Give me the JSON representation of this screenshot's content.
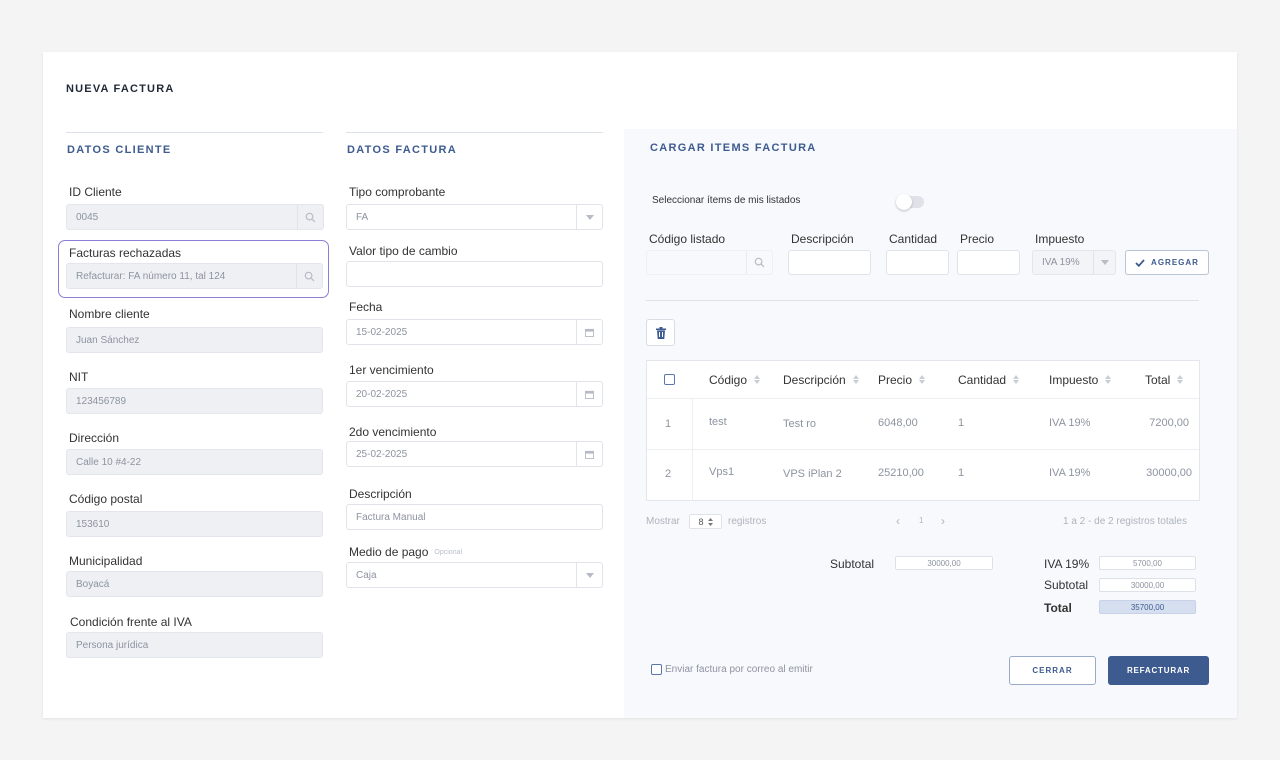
{
  "page": {
    "title": "NUEVA FACTURA"
  },
  "cliente": {
    "section_title": "DATOS CLIENTE",
    "id_label": "ID Cliente",
    "id_value": "0045",
    "rechazadas_label": "Facturas rechazadas",
    "rechazadas_value": "Refacturar: FA número 11, tal 124",
    "nombre_label": "Nombre cliente",
    "nombre_value": "Juan Sánchez",
    "nit_label": "NIT",
    "nit_value": "123456789",
    "direccion_label": "Dirección",
    "direccion_value": "Calle 10 #4-22",
    "postal_label": "Código postal",
    "postal_value": "153610",
    "municipalidad_label": "Municipalidad",
    "municipalidad_value": "Boyacá",
    "iva_label": "Condición frente al IVA",
    "iva_value": "Persona jurídica"
  },
  "factura": {
    "section_title": "DATOS FACTURA",
    "tipo_label": "Tipo comprobante",
    "tipo_value": "FA",
    "cambio_label": "Valor tipo de cambio",
    "cambio_value": "",
    "fecha_label": "Fecha",
    "fecha_value": "15-02-2025",
    "venc1_label": "1er vencimiento",
    "venc1_value": "20-02-2025",
    "venc2_label": "2do vencimiento",
    "venc2_value": "25-02-2025",
    "descripcion_label": "Descripción",
    "descripcion_value": "Factura Manual",
    "pago_label": "Medio de pago",
    "pago_optional": "Opcional",
    "pago_value": "Caja"
  },
  "items": {
    "section_title": "CARGAR ITEMS FACTURA",
    "toggle_label": "Seleccionar ítems de mis listados",
    "toggle_on": false,
    "codigo_label": "Código listado",
    "descripcion_label": "Descripción",
    "cantidad_label": "Cantidad",
    "precio_label": "Precio",
    "impuesto_label": "Impuesto",
    "impuesto_value": "IVA 19%",
    "add_label": "AGREGAR"
  },
  "table": {
    "headers": {
      "codigo": "Código",
      "descripcion": "Descripción",
      "precio": "Precio",
      "cantidad": "Cantidad",
      "impuesto": "Impuesto",
      "total": "Total"
    },
    "rows": [
      {
        "n": "1",
        "codigo": "test",
        "descripcion": "Test ro",
        "precio": "6048,00",
        "cantidad": "1",
        "impuesto": "IVA 19%",
        "total": "7200,00"
      },
      {
        "n": "2",
        "codigo": "Vps1",
        "descripcion": "VPS iPlan 2",
        "precio": "25210,00",
        "cantidad": "1",
        "impuesto": "IVA 19%",
        "total": "30000,00"
      }
    ]
  },
  "pagination": {
    "show_label": "Mostrar",
    "per_page": "8",
    "records_label": "registros",
    "page": "1",
    "summary": "1 a 2 - de 2 registros totales"
  },
  "totals": {
    "subtotal_left_label": "Subtotal",
    "subtotal_left_value": "30000,00",
    "iva_label": "IVA 19%",
    "iva_value": "5700,00",
    "subtotal_label": "Subtotal",
    "subtotal_value": "30000,00",
    "total_label": "Total",
    "total_value": "35700,00"
  },
  "footer": {
    "email_label": "Enviar factura por correo al emitir",
    "email_checked": false,
    "close_label": "CERRAR",
    "refacturar_label": "REFACTURAR"
  },
  "colors": {
    "accent": "#3d5b8f",
    "highlight_border": "#8b7fd4",
    "total_fill": "#d6dff0"
  }
}
